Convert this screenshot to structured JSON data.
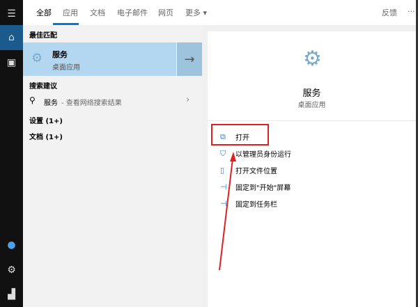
{
  "tabs": [
    "全部",
    "应用",
    "文档",
    "电子邮件",
    "网页",
    "更多 ▾"
  ],
  "feedback": "反馈",
  "more_dots": "···",
  "left": {
    "best_match_header": "最佳匹配",
    "best_title": "服务",
    "best_subtitle": "桌面应用",
    "suggest_header": "搜索建议",
    "suggest_term": "服务",
    "suggest_hint": " - 查看网络搜索结果",
    "settings": "设置 (1+)",
    "documents": "文档 (1+)"
  },
  "right": {
    "title": "服务",
    "subtitle": "桌面应用",
    "actions": [
      "打开",
      "以管理员身份运行",
      "打开文件位置",
      "固定到\"开始\"屏幕",
      "固定到任务栏"
    ]
  },
  "colors": {
    "accent": "#0078d7",
    "highlight": "#b3d7f0",
    "annotation": "#e02020"
  }
}
